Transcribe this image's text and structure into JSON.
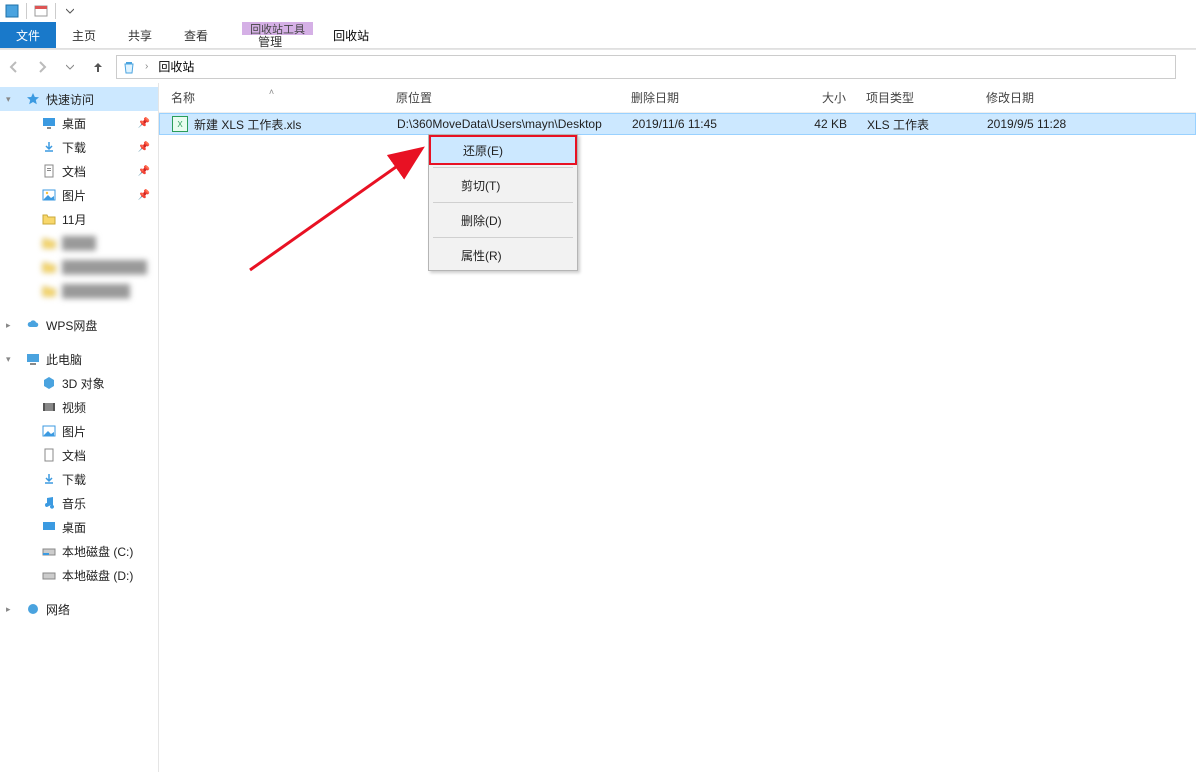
{
  "qat": {
    "tooltip": ""
  },
  "ribbon": {
    "file": "文件",
    "tabs": [
      "主页",
      "共享",
      "查看"
    ],
    "context_group": "回收站工具",
    "context_tab": "管理",
    "window_title": "回收站"
  },
  "nav": {
    "crumb_root": "回收站"
  },
  "sidebar": {
    "quick_access": "快速访问",
    "quick": [
      {
        "label": "桌面",
        "pinned": true
      },
      {
        "label": "下载",
        "pinned": true
      },
      {
        "label": "文档",
        "pinned": true
      },
      {
        "label": "图片",
        "pinned": true
      },
      {
        "label": "11月",
        "pinned": false
      }
    ],
    "wps": "WPS网盘",
    "this_pc": "此电脑",
    "pc": [
      "3D 对象",
      "视频",
      "图片",
      "文档",
      "下载",
      "音乐",
      "桌面",
      "本地磁盘 (C:)",
      "本地磁盘 (D:)"
    ],
    "network": "网络"
  },
  "columns": {
    "name": "名称",
    "loc": "原位置",
    "ddate": "删除日期",
    "size": "大小",
    "type": "项目类型",
    "mdate": "修改日期"
  },
  "file": {
    "name": "新建 XLS 工作表.xls",
    "loc": "D:\\360MoveData\\Users\\mayn\\Desktop",
    "ddate": "2019/11/6 11:45",
    "size": "42 KB",
    "type": "XLS 工作表",
    "mdate": "2019/9/5 11:28"
  },
  "ctxmenu": {
    "restore": "还原(E)",
    "cut": "剪切(T)",
    "delete": "删除(D)",
    "properties": "属性(R)"
  }
}
